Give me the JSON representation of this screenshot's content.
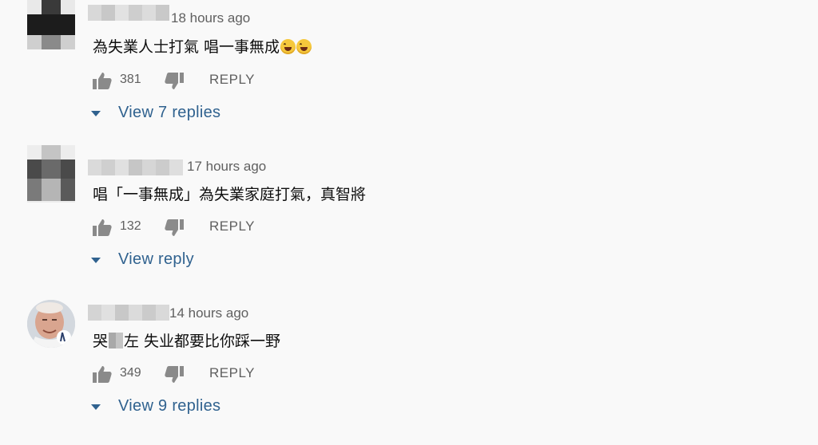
{
  "comments": [
    {
      "time": "18 hours ago",
      "text": "為失業人士打氣 唱一事無成",
      "emoji_icons": [
        "laughing-emoji-icon",
        "laughing-emoji-icon"
      ],
      "likes": "381",
      "reply_label": "REPLY",
      "view_replies_label": "View 7 replies"
    },
    {
      "time": "17 hours ago",
      "text": "唱「一事無成」為失業家庭打氣，真智將",
      "likes": "132",
      "reply_label": "REPLY",
      "view_replies_label": "View reply"
    },
    {
      "time": "14 hours ago",
      "text_before": "哭",
      "text_after": "左 失业都要比你踩一野",
      "likes": "349",
      "reply_label": "REPLY",
      "view_replies_label": "View 9 replies"
    }
  ],
  "colors": {
    "background": "#f9f9f9",
    "link": "#30628f",
    "secondary_text": "#606060"
  }
}
